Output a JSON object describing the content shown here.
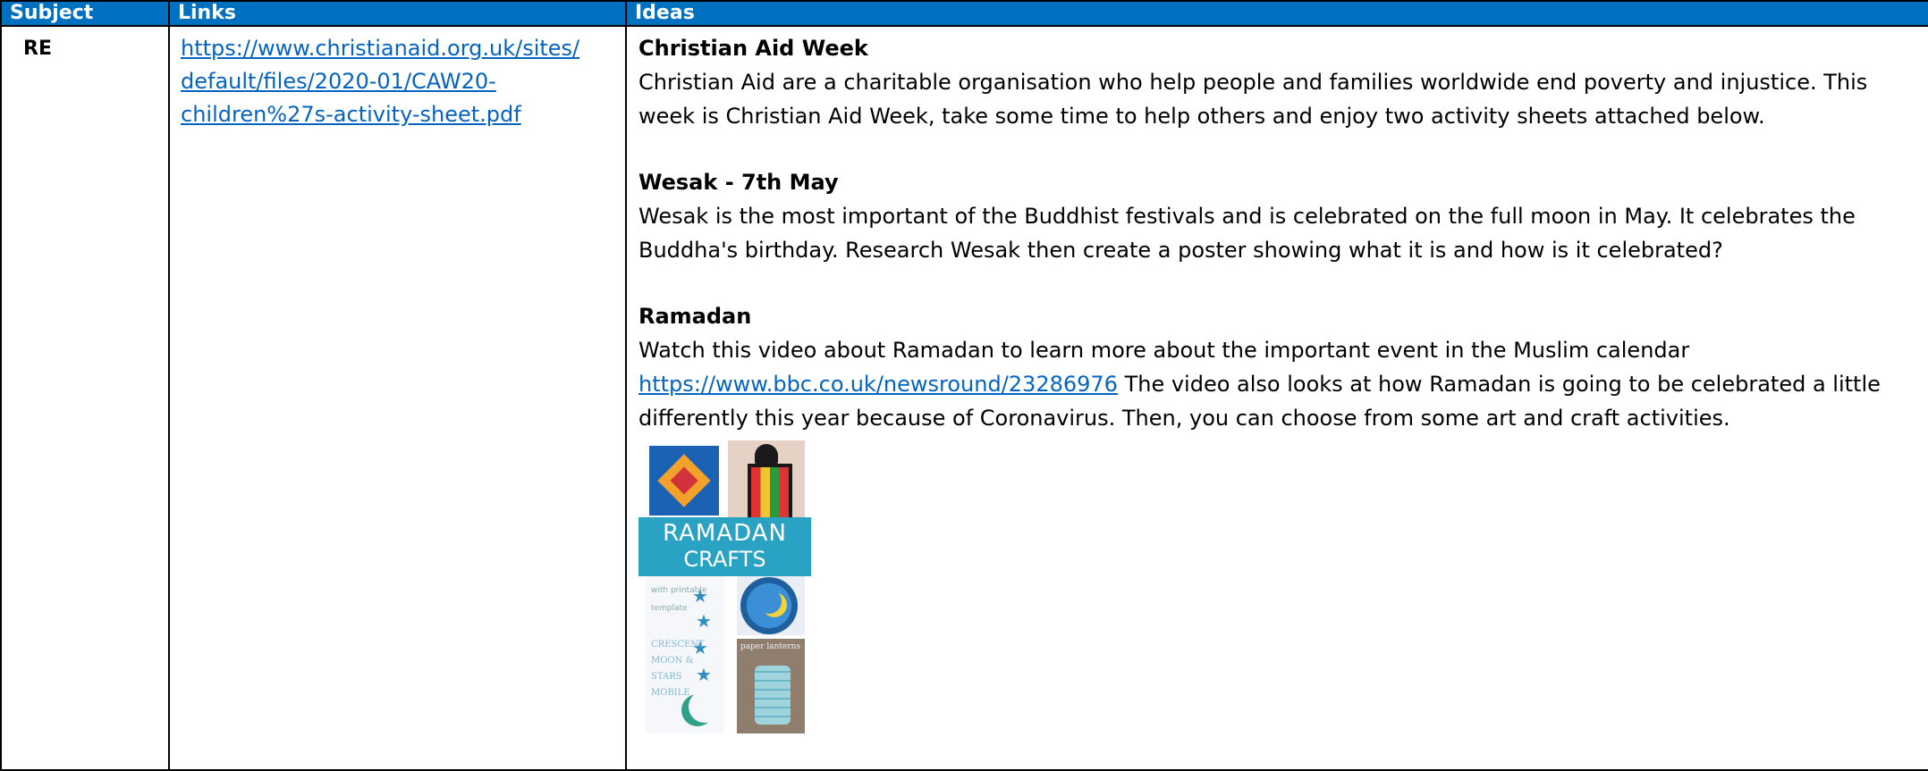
{
  "table": {
    "headers": {
      "subject": "Subject",
      "links": "Links",
      "ideas": "Ideas"
    }
  },
  "row": {
    "subject": "RE",
    "link": "https://www.christianaid.org.uk/sites/default/files/2020-01/CAW20-children%27s-activity-sheet.pdf",
    "link_lines": [
      "https://www.christianaid.org.uk/sites/",
      "default/files/2020-01/CAW20-",
      "children%27s-activity-sheet.pdf"
    ],
    "sections": {
      "christian_aid": {
        "title": "Christian Aid Week",
        "body": "Christian Aid are a charitable organisation who help people and families worldwide end poverty and injustice. This week is Christian Aid Week, take some time to help others and enjoy two activity sheets attached below."
      },
      "wesak": {
        "title": "Wesak - 7th May",
        "body": "Wesak is the most important of the Buddhist festivals and is celebrated on the full moon in May. It celebrates the Buddha's birthday. Research Wesak then create a poster showing what it is and how is it celebrated?"
      },
      "ramadan": {
        "title": "Ramadan",
        "body_before_link": "Watch this video about Ramadan to learn more about the important event in the Muslim calendar ",
        "link": "https://www.bbc.co.uk/newsround/23286976",
        "body_after_link": " The video also looks at how Ramadan is going to be celebrated a little differently this year because of Coronavirus. Then, you can choose from some art and craft activities."
      }
    },
    "image": {
      "banner_line1": "RAMADAN",
      "banner_line2": "CRAFTS",
      "mobile_caption": "CRESCENT MOON & STARS MOBILE",
      "template_note": "with printable template",
      "paper_lanterns_label": "paper lanterns"
    }
  },
  "colors": {
    "header_bg": "#0070c0",
    "header_text": "#ffffff",
    "link": "#0563c1",
    "banner": "#2aa2c3"
  }
}
